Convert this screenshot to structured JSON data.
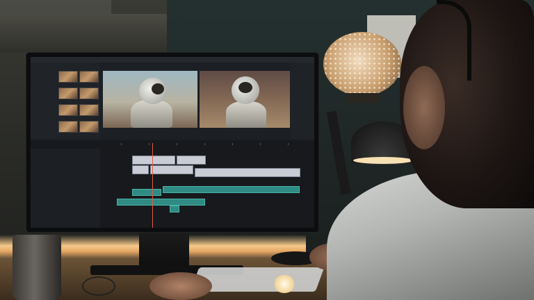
{
  "scene": {
    "subject": "",
    "monitor": {
      "app": {
        "window_title": "",
        "panels": [
          "",
          ""
        ],
        "viewer_source_label": "",
        "viewer_program_label": ""
      }
    }
  },
  "colors": {
    "wall": "#1f2726",
    "lamp_glow": "#f5c98a",
    "audio_clip": "#2f8b83",
    "video_clip": "#c9ccd4",
    "playhead": "#e25a4a"
  }
}
